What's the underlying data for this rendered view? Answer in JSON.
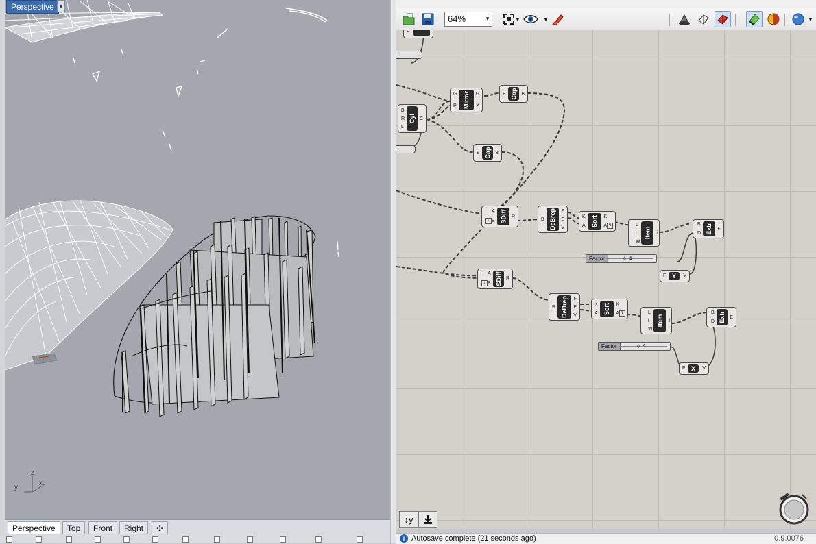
{
  "rhino": {
    "viewport_title": "Perspective",
    "viewport_tabs": [
      "Perspective",
      "Top",
      "Front",
      "Right"
    ],
    "active_tab": "Perspective",
    "axis_labels": {
      "x": "x",
      "y": "y",
      "z": "z"
    }
  },
  "grasshopper": {
    "zoom": "64%",
    "status_text": "Autosave complete (21 seconds ago)",
    "version": "0.9.0076",
    "components": {
      "mirror": {
        "label": "Mirror",
        "inputs": [
          "G",
          "P"
        ],
        "outputs": [
          "G",
          "X"
        ]
      },
      "cap1": {
        "label": "Cap",
        "inputs": [
          "B"
        ],
        "outputs": [
          "B"
        ]
      },
      "cyl": {
        "label": "Cyl",
        "inputs": [
          "B",
          "R",
          "L"
        ],
        "outputs": [
          "C"
        ]
      },
      "cap2": {
        "label": "Cap",
        "inputs": [
          "B"
        ],
        "outputs": [
          "B"
        ]
      },
      "sdiff1": {
        "label": "SDiff",
        "inputs": [
          "A",
          "B"
        ],
        "outputs": [
          "R"
        ]
      },
      "debrep1": {
        "label": "DeBrep",
        "inputs": [
          "B"
        ],
        "outputs": [
          "F",
          "E",
          "V"
        ]
      },
      "sort1": {
        "label": "Sort",
        "inputs": [
          "K",
          "A"
        ],
        "outputs": [
          "K",
          "A"
        ]
      },
      "item1": {
        "label": "Item",
        "inputs": [
          "L",
          "i",
          "W"
        ],
        "outputs": [
          "i"
        ]
      },
      "extr1": {
        "label": "Extr",
        "inputs": [
          "B",
          "D"
        ],
        "outputs": [
          "E"
        ]
      },
      "y": {
        "label": "Y",
        "inputs": [
          "F"
        ],
        "outputs": [
          "V"
        ]
      },
      "sdiff2": {
        "label": "SDiff",
        "inputs": [
          "A",
          "B"
        ],
        "outputs": [
          "R"
        ]
      },
      "debrep2": {
        "label": "DeBrep",
        "inputs": [
          "B"
        ],
        "outputs": [
          "F",
          "E",
          "V"
        ]
      },
      "sort2": {
        "label": "Sort",
        "inputs": [
          "K",
          "A"
        ],
        "outputs": [
          "K",
          "A"
        ]
      },
      "item2": {
        "label": "Item",
        "inputs": [
          "L",
          "i",
          "W"
        ],
        "outputs": [
          "i"
        ]
      },
      "extr2": {
        "label": "Extr",
        "inputs": [
          "B",
          "D"
        ],
        "outputs": [
          "E"
        ]
      },
      "x": {
        "label": "X",
        "inputs": [
          "F"
        ],
        "outputs": [
          "V"
        ]
      }
    },
    "sliders": [
      {
        "label": "Factor",
        "value": "4"
      },
      {
        "label": "Factor",
        "value": "4"
      }
    ],
    "top_partial_port": "L"
  }
}
